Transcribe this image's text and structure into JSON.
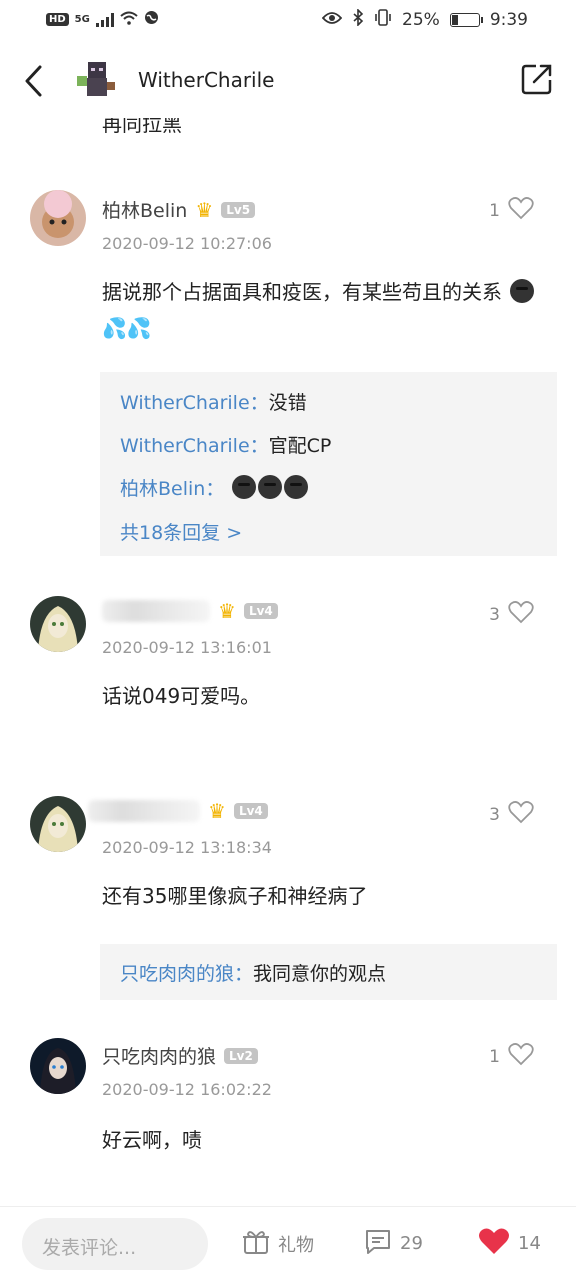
{
  "status_bar": {
    "hd": "HD",
    "network": "5G",
    "battery": "25%",
    "time": "9:39"
  },
  "header": {
    "title": "WitherCharile",
    "avatar_icon": "minecraft-avatar",
    "back_icon": "back-arrow-icon",
    "share_icon": "share-icon"
  },
  "partial_text": "再同拉黑",
  "comments": [
    {
      "user": "柏林Belin",
      "level": "Lv5",
      "has_crown": true,
      "date": "2020-09-12 10:27:06",
      "likes": "1",
      "text": "据说那个占据面具和疫医，有某些苟且的关系",
      "replies": [
        {
          "user": "WitherCharile：",
          "text": "没错"
        },
        {
          "user": "WitherCharile：",
          "text": "官配CP"
        },
        {
          "user": "柏林Belin：",
          "text": ""
        }
      ],
      "more": "共18条回复 >"
    },
    {
      "user": "",
      "level": "Lv4",
      "has_crown": true,
      "date": "2020-09-12 13:16:01",
      "likes": "3",
      "text": "话说049可爱吗。"
    },
    {
      "user": "",
      "level": "Lv4",
      "has_crown": true,
      "date": "2020-09-12 13:18:34",
      "likes": "3",
      "text": "还有35哪里像疯子和神经病了",
      "replies": [
        {
          "user": "只吃肉肉的狼：",
          "text": "我同意你的观点"
        }
      ]
    },
    {
      "user": "只吃肉肉的狼",
      "level": "Lv2",
      "has_crown": false,
      "date": "2020-09-12 16:02:22",
      "likes": "1",
      "text": "好云啊，啧"
    }
  ],
  "bottom_bar": {
    "input_placeholder": "发表评论...",
    "gift_label": "礼物",
    "comment_count": "29",
    "like_count": "14"
  },
  "colors": {
    "link_blue": "#4a86c6",
    "heart_red": "#e8334a",
    "crown_gold": "#f2b300"
  }
}
